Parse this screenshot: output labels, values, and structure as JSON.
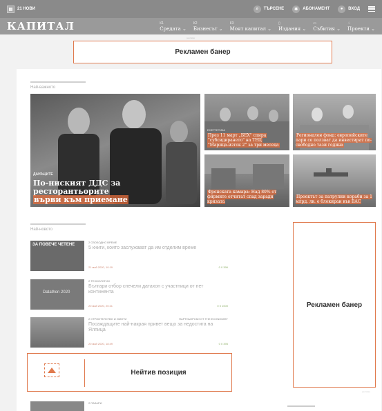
{
  "topbar": {
    "news_label": "21 НОВИ",
    "search_label": "ТЪРСЕНЕ",
    "subscription_label": "АБОНАМЕНТ",
    "login_label": "ВХОД"
  },
  "navbar": {
    "logo": "КАПИТАЛ",
    "menu": [
      {
        "code": "К1",
        "label": "Средата"
      },
      {
        "code": "К2",
        "label": "Бизнесът"
      },
      {
        "code": "К3",
        "label": "Моят капитал"
      },
      {
        "code": "",
        "label": "Издания"
      },
      {
        "code": "",
        "label": "Събития"
      },
      {
        "code": "",
        "label": "Проекти"
      }
    ]
  },
  "ads": {
    "top_caption": "реклама",
    "top_banner": "Рекламен банер",
    "side_banner": "Рекламен банер",
    "side_caption": "реклама",
    "native": "Нейтив позиция"
  },
  "sections": {
    "important": "Най-важното",
    "latest": "Най-новото"
  },
  "top_stories": [
    {
      "kicker": "ДАНЪЦИТЕ",
      "title": "По-ниският ДДС за ресторантьорите",
      "title_hl": "върви към приемане"
    },
    {
      "kicker": "ЕНЕРГЕТИКА",
      "title": "През 11 март „БЕХ\" спира",
      "title2": "\"субсидирането\" на ТЕЦ",
      "title3": "\"Марица-изток 2\" за три месеца"
    },
    {
      "kicker": "",
      "title": "Регионален фонд: европейските пари се ползват да инвестират по-свободно тази година"
    },
    {
      "kicker": "",
      "title": "Френската камара: Над 80% от фирмите отчитат спад заради кризата"
    },
    {
      "kicker": "",
      "title": "Проектът за патрулни кораби за 1 млрд. лв. е блокиран във ВАС"
    }
  ],
  "latest": [
    {
      "kicker": "2 СВОБОДНО ВРЕМЕ",
      "kicker2": "",
      "title": "5 книги, които заслужават да им отделим време",
      "meta": "21 май 2020, 10:19",
      "stats": "0   0   396"
    },
    {
      "kicker": "2 ТЕХНОЛОГИИ",
      "kicker2": "",
      "title": "Българи отбор спечели датахон с участници от пет континента",
      "meta": "20 май 2020, 20:21",
      "stats": "0   0   1000"
    },
    {
      "kicker": "2 СТРОИТЕЛСТВО И ИМОТИ",
      "kicker2": "ПАРТНЬОРСКИ ОТ THE ECONOMIST",
      "title": "Посаждащите най-накрая привет вещо за недостига на Ялпица",
      "meta": "20 май 2020, 18:49",
      "stats": "0   0   395"
    },
    {
      "kicker": "2 ПАЗАРИ",
      "kicker2": "",
      "title": "",
      "meta": "",
      "stats": ""
    }
  ],
  "thumbs": {
    "read_more": "ЗА ПОВЕЧЕ ЧЕТЕНЕ",
    "datathon": "Datathon 2020"
  }
}
